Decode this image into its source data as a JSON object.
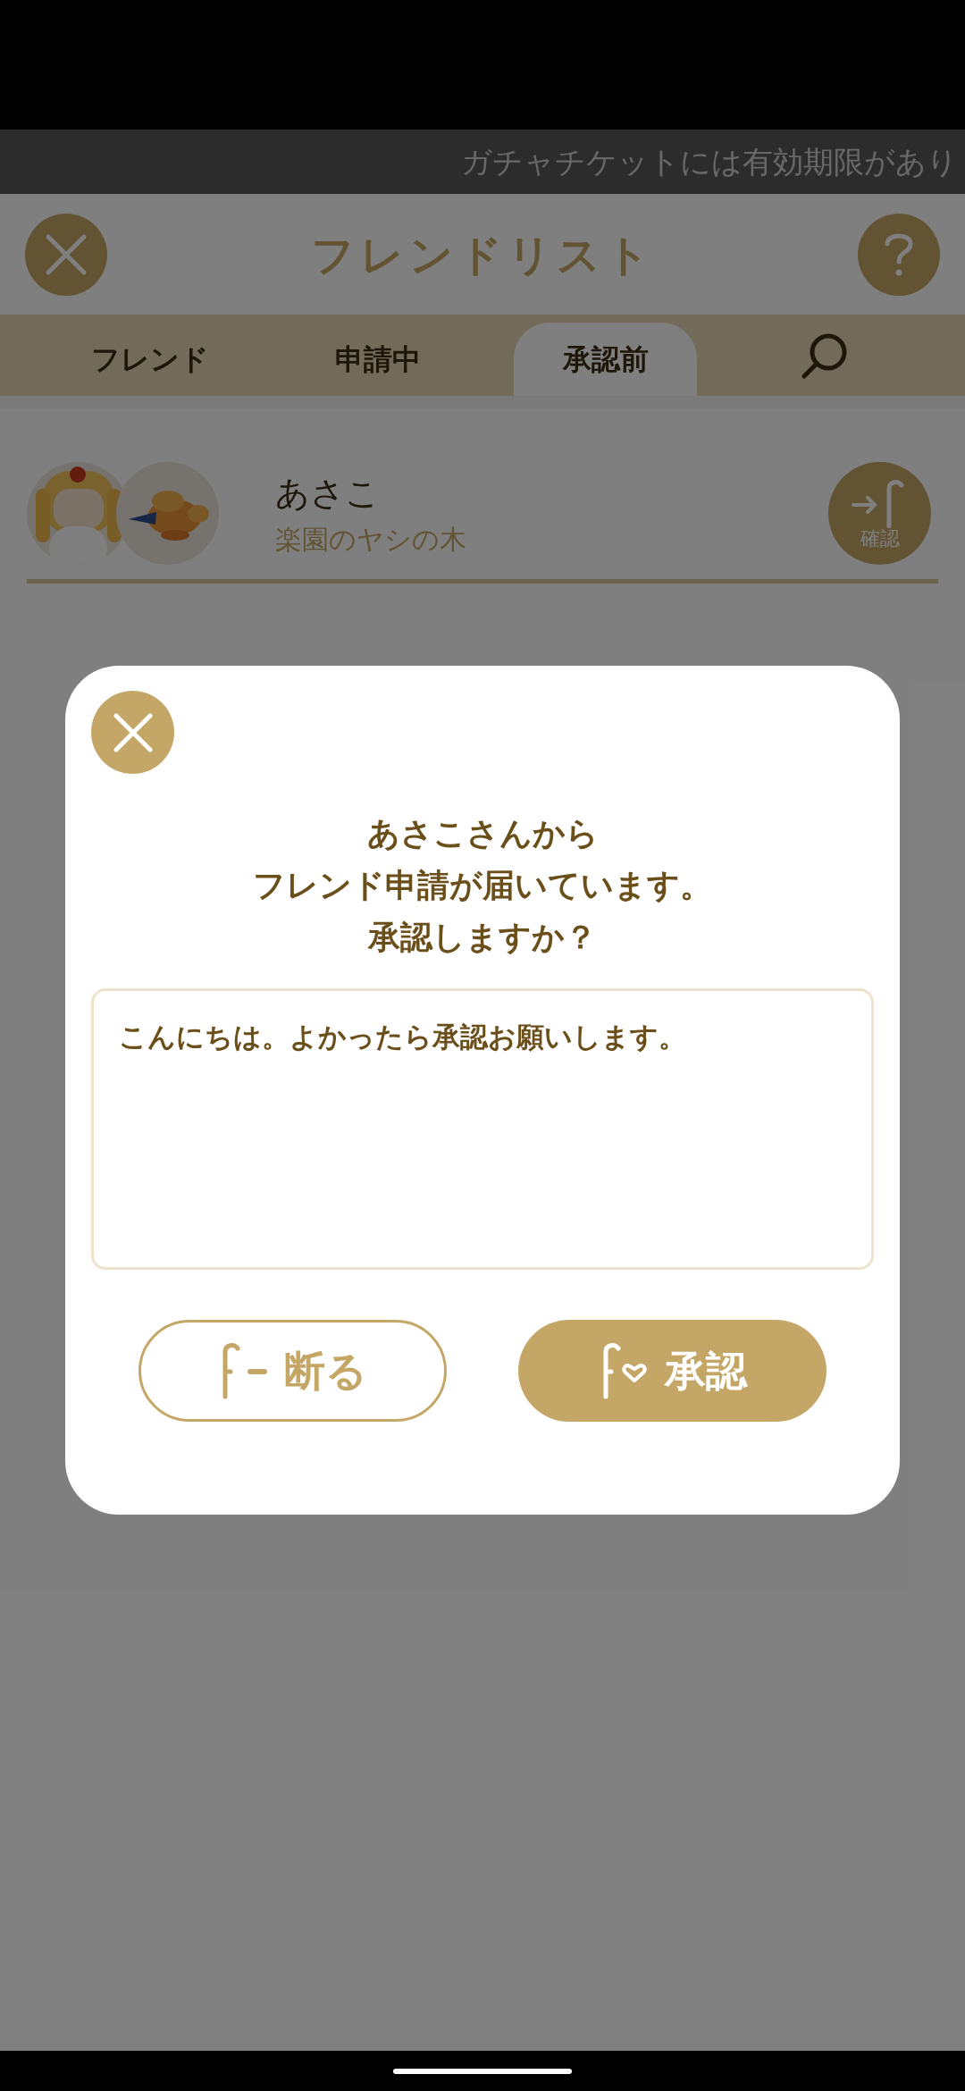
{
  "status_banner": {
    "text": "ガチャチケットには有効期限があり"
  },
  "header": {
    "title": "フレンドリスト"
  },
  "tabs": [
    {
      "label": "フレンド",
      "selected": false
    },
    {
      "label": "申請中",
      "selected": false
    },
    {
      "label": "承認前",
      "selected": true
    }
  ],
  "friends": [
    {
      "name": "あさこ",
      "subtitle": "楽園のヤシの木",
      "action": "確認"
    }
  ],
  "dialog": {
    "title_lines": [
      "あさこさんから",
      "フレンド申請が届いています。",
      "承認しますか？"
    ],
    "message": "こんにちは。よかったら承認お願いします。",
    "buttons": [
      {
        "kind": "decline",
        "label": "断る"
      },
      {
        "kind": "accept",
        "label": "承認"
      }
    ]
  }
}
